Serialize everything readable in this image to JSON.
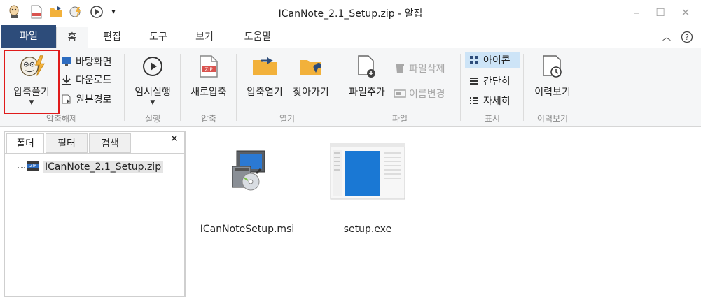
{
  "window": {
    "title": "ICanNote_2.1_Setup.zip - 알집",
    "quick_access_more": "▾"
  },
  "tabs": [
    "파일",
    "홈",
    "편집",
    "도구",
    "보기",
    "도움말"
  ],
  "ribbon": {
    "extract": {
      "main_label": "압축풀기",
      "desktop": "바탕화면",
      "downloads": "다운로드",
      "original_path": "원본경로",
      "group_label": "압축해제"
    },
    "run": {
      "label": "임시실행",
      "group_label": "실행"
    },
    "compress": {
      "label": "새로압축",
      "group_label": "압축"
    },
    "open": {
      "open_archive": "압축열기",
      "goto": "찾아가기",
      "group_label": "열기"
    },
    "file": {
      "add": "파일추가",
      "delete": "파일삭제",
      "rename": "이름변경",
      "group_label": "파일"
    },
    "view": {
      "icons": "아이콘",
      "simple": "간단히",
      "detail": "자세히",
      "group_label": "표시"
    },
    "history": {
      "label": "이력보기",
      "group_label": "이력보기"
    }
  },
  "left_pane": {
    "tabs": [
      "폴더",
      "필터",
      "검색"
    ],
    "close": "✕",
    "tree_root": "ICanNote_2.1_Setup.zip"
  },
  "files": [
    {
      "name": "ICanNoteSetup.msi",
      "icon": "msi-installer-icon"
    },
    {
      "name": "setup.exe",
      "icon": "exe-window-icon"
    }
  ],
  "colors": {
    "file_tab": "#2d4c7a",
    "highlight": "#e01b1b",
    "folder": "#f2b13b",
    "zip_red": "#d9534f"
  }
}
